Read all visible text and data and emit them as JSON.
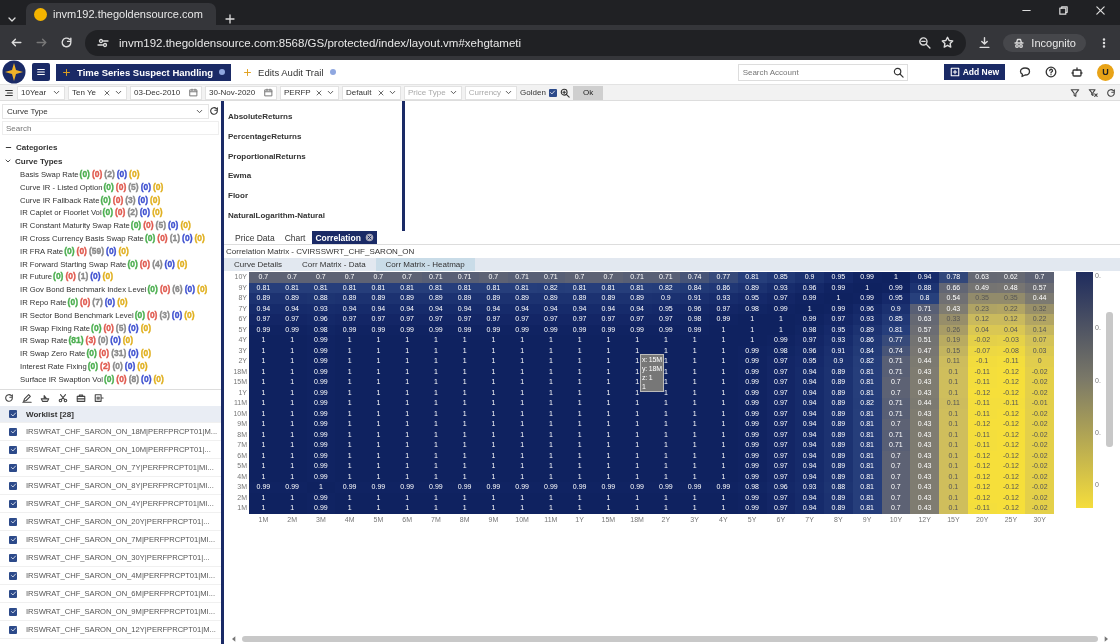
{
  "browser": {
    "tab_title": "invm192.thegoldensource.com",
    "url": "invm192.thegoldensource.com:8568/GS/protected/index/layout.vm#xehgtameti",
    "profile": "Incognito"
  },
  "app_tabs": [
    {
      "label": "Time Series Suspect Handling",
      "selected": true
    },
    {
      "label": "Edits Audit Trail",
      "selected": false
    }
  ],
  "search_account": {
    "placeholder": "Search Account"
  },
  "add_button": "Add New",
  "avatar": "U",
  "filters": [
    {
      "kind": "select",
      "value": "10Year",
      "clear": false
    },
    {
      "kind": "select",
      "value": "Ten Ye",
      "clear": true
    },
    {
      "kind": "date",
      "value": "03-Dec-2010"
    },
    {
      "kind": "date",
      "value": "30-Nov-2020"
    },
    {
      "kind": "select",
      "value": "PERFP",
      "clear": true
    },
    {
      "kind": "select",
      "value": "Default",
      "clear": true
    },
    {
      "kind": "select",
      "placeholder": "Price Type",
      "clear": false
    },
    {
      "kind": "select",
      "placeholder": "Currency",
      "clear": false
    },
    {
      "kind": "checkbox",
      "label": "Golden",
      "checked": true
    },
    {
      "kind": "button",
      "label": "Ok"
    }
  ],
  "curve_select": {
    "value": "Curve Type"
  },
  "tree_search": {
    "placeholder": "Search"
  },
  "tree": {
    "label": "Categories",
    "expanded": true,
    "children": [
      {
        "label": "Curve Types",
        "expanded": true,
        "children": [
          {
            "label": "Basis Swap Rate",
            "counts": [
              {
                "text": "(0)",
                "color": "#4caf50"
              },
              {
                "text": "(0)",
                "color": "#e05a4f"
              },
              {
                "text": "(2)",
                "color": "#8a8a8a"
              },
              {
                "text": "(0)",
                "color": "#3f51d0"
              },
              {
                "text": "(0)",
                "color": "#e0b020"
              }
            ]
          },
          {
            "label": "Curve IR - Listed Option",
            "counts": [
              {
                "text": "(0)",
                "color": "#4caf50"
              },
              {
                "text": "(0)",
                "color": "#e05a4f"
              },
              {
                "text": "(5)",
                "color": "#8a8a8a"
              },
              {
                "text": "(0)",
                "color": "#3f51d0"
              },
              {
                "text": "(0)",
                "color": "#e0b020"
              }
            ]
          },
          {
            "label": "Curve IR Fallback Rate",
            "counts": [
              {
                "text": "(0)",
                "color": "#4caf50"
              },
              {
                "text": "(0)",
                "color": "#e05a4f"
              },
              {
                "text": "(3)",
                "color": "#8a8a8a"
              },
              {
                "text": "(0)",
                "color": "#3f51d0"
              },
              {
                "text": "(0)",
                "color": "#e0b020"
              }
            ]
          },
          {
            "label": "IR Caplet or Floorlet Vol",
            "counts": [
              {
                "text": "(0)",
                "color": "#4caf50"
              },
              {
                "text": "(0)",
                "color": "#e05a4f"
              },
              {
                "text": "(2)",
                "color": "#8a8a8a"
              },
              {
                "text": "(0)",
                "color": "#3f51d0"
              },
              {
                "text": "(0)",
                "color": "#e0b020"
              }
            ]
          },
          {
            "label": "IR Constant Maturity Swap Rate",
            "counts": [
              {
                "text": "(0)",
                "color": "#4caf50"
              },
              {
                "text": "(0)",
                "color": "#e05a4f"
              },
              {
                "text": "(5)",
                "color": "#8a8a8a"
              },
              {
                "text": "(0)",
                "color": "#3f51d0"
              },
              {
                "text": "(0)",
                "color": "#e0b020"
              }
            ]
          },
          {
            "label": "IR Cross Currency Basis Swap Rate",
            "counts": [
              {
                "text": "(0)",
                "color": "#4caf50"
              },
              {
                "text": "(0)",
                "color": "#e05a4f"
              },
              {
                "text": "(1)",
                "color": "#8a8a8a"
              },
              {
                "text": "(0)",
                "color": "#3f51d0"
              },
              {
                "text": "(0)",
                "color": "#e0b020"
              }
            ]
          },
          {
            "label": "IR FRA Rate",
            "counts": [
              {
                "text": "(0)",
                "color": "#4caf50"
              },
              {
                "text": "(0)",
                "color": "#e05a4f"
              },
              {
                "text": "(59)",
                "color": "#8a8a8a"
              },
              {
                "text": "(0)",
                "color": "#3f51d0"
              },
              {
                "text": "(0)",
                "color": "#e0b020"
              }
            ]
          },
          {
            "label": "IR Forward Starting Swap Rate",
            "counts": [
              {
                "text": "(0)",
                "color": "#4caf50"
              },
              {
                "text": "(0)",
                "color": "#e05a4f"
              },
              {
                "text": "(4)",
                "color": "#8a8a8a"
              },
              {
                "text": "(0)",
                "color": "#3f51d0"
              },
              {
                "text": "(0)",
                "color": "#e0b020"
              }
            ]
          },
          {
            "label": "IR Future",
            "counts": [
              {
                "text": "(0)",
                "color": "#4caf50"
              },
              {
                "text": "(0)",
                "color": "#e05a4f"
              },
              {
                "text": "(1)",
                "color": "#8a8a8a"
              },
              {
                "text": "(0)",
                "color": "#3f51d0"
              },
              {
                "text": "(0)",
                "color": "#e0b020"
              }
            ]
          },
          {
            "label": "IR Gov Bond Benchmark Index Level",
            "counts": [
              {
                "text": "(0)",
                "color": "#4caf50"
              },
              {
                "text": "(0)",
                "color": "#e05a4f"
              },
              {
                "text": "(6)",
                "color": "#8a8a8a"
              },
              {
                "text": "(0)",
                "color": "#3f51d0"
              },
              {
                "text": "(0)",
                "color": "#e0b020"
              }
            ]
          },
          {
            "label": "IR Repo Rate",
            "counts": [
              {
                "text": "(0)",
                "color": "#4caf50"
              },
              {
                "text": "(0)",
                "color": "#e05a4f"
              },
              {
                "text": "(7)",
                "color": "#8a8a8a"
              },
              {
                "text": "(0)",
                "color": "#3f51d0"
              },
              {
                "text": "(0)",
                "color": "#e0b020"
              }
            ]
          },
          {
            "label": "IR Sector Bond Benchmark Level",
            "counts": [
              {
                "text": "(0)",
                "color": "#4caf50"
              },
              {
                "text": "(0)",
                "color": "#e05a4f"
              },
              {
                "text": "(3)",
                "color": "#8a8a8a"
              },
              {
                "text": "(0)",
                "color": "#3f51d0"
              },
              {
                "text": "(0)",
                "color": "#e0b020"
              }
            ]
          },
          {
            "label": "IR Swap Fixing Rate",
            "counts": [
              {
                "text": "(0)",
                "color": "#4caf50"
              },
              {
                "text": "(0)",
                "color": "#e05a4f"
              },
              {
                "text": "(5)",
                "color": "#8a8a8a"
              },
              {
                "text": "(0)",
                "color": "#3f51d0"
              },
              {
                "text": "(0)",
                "color": "#e0b020"
              }
            ]
          },
          {
            "label": "IR Swap Rate",
            "counts": [
              {
                "text": "(81)",
                "color": "#4caf50"
              },
              {
                "text": "(3)",
                "color": "#e05a4f"
              },
              {
                "text": "(0)",
                "color": "#8a8a8a"
              },
              {
                "text": "(0)",
                "color": "#3f51d0"
              },
              {
                "text": "(0)",
                "color": "#e0b020"
              }
            ]
          },
          {
            "label": "IR Swap Zero Rate",
            "counts": [
              {
                "text": "(0)",
                "color": "#4caf50"
              },
              {
                "text": "(0)",
                "color": "#e05a4f"
              },
              {
                "text": "(31)",
                "color": "#8a8a8a"
              },
              {
                "text": "(0)",
                "color": "#3f51d0"
              },
              {
                "text": "(0)",
                "color": "#e0b020"
              }
            ]
          },
          {
            "label": "Interest Rate Fixing",
            "counts": [
              {
                "text": "(0)",
                "color": "#4caf50"
              },
              {
                "text": "(2)",
                "color": "#e05a4f"
              },
              {
                "text": "(0)",
                "color": "#8a8a8a"
              },
              {
                "text": "(0)",
                "color": "#3f51d0"
              },
              {
                "text": "(0)",
                "color": "#e0b020"
              }
            ]
          },
          {
            "label": "Surface IR Swaption Vol",
            "counts": [
              {
                "text": "(0)",
                "color": "#4caf50"
              },
              {
                "text": "(0)",
                "color": "#e05a4f"
              },
              {
                "text": "(8)",
                "color": "#8a8a8a"
              },
              {
                "text": "(0)",
                "color": "#3f51d0"
              },
              {
                "text": "(0)",
                "color": "#e0b020"
              }
            ]
          }
        ]
      }
    ]
  },
  "worklist": {
    "title": "Worklist [28]",
    "checked": true,
    "items": [
      {
        "label": "IRSWRAT_CHF_SARON_ON_18M|PERFPRCPT01|M...",
        "checked": true
      },
      {
        "label": "IRSWRAT_CHF_SARON_ON_10M|PERFPRCPT01|...",
        "checked": true
      },
      {
        "label": "IRSWRAT_CHF_SARON_ON_7Y|PERFPRCPT01|MI...",
        "checked": true
      },
      {
        "label": "IRSWRAT_CHF_SARON_ON_8Y|PERFPRCPT01|MI...",
        "checked": true
      },
      {
        "label": "IRSWRAT_CHF_SARON_ON_4Y|PERFPRCPT01|MI...",
        "checked": true
      },
      {
        "label": "IRSWRAT_CHF_SARON_ON_20Y|PERFPRCPT01|...",
        "checked": true
      },
      {
        "label": "IRSWRAT_CHF_SARON_ON_7M|PERFPRCPT01|MI...",
        "checked": true
      },
      {
        "label": "IRSWRAT_CHF_SARON_ON_30Y|PERFPRCPT01|...",
        "checked": true
      },
      {
        "label": "IRSWRAT_CHF_SARON_ON_4M|PERFPRCPT01|MI...",
        "checked": true
      },
      {
        "label": "IRSWRAT_CHF_SARON_ON_6M|PERFPRCPT01|MI...",
        "checked": true
      },
      {
        "label": "IRSWRAT_CHF_SARON_ON_9M|PERFPRCPT01|MI...",
        "checked": true
      },
      {
        "label": "IRSWRAT_CHF_SARON_ON_12Y|PERFPRCPT01|M...",
        "checked": true
      }
    ]
  },
  "functions": [
    "AbsoluteReturns",
    "PercentageReturns",
    "ProportionalReturns",
    "Ewma",
    "Floor",
    "NaturalLogarithm-Natural"
  ],
  "view_tabs": [
    {
      "label": "Price Data",
      "selected": false,
      "closable": false
    },
    {
      "label": "Chart",
      "selected": false,
      "closable": false
    },
    {
      "label": "Correlation",
      "selected": true,
      "closable": true
    }
  ],
  "matrix_title": "Correlation Matrix - CVIRSSWRT_CHF_SARON_ON",
  "sub_tabs": [
    {
      "label": "Curve Details",
      "selected": false
    },
    {
      "label": "Corr Matrix - Data",
      "selected": false
    },
    {
      "label": "Corr Matrix - Heatmap",
      "selected": true
    }
  ],
  "heatmap": {
    "columns": [
      "1M",
      "2M",
      "3M",
      "4M",
      "5M",
      "6M",
      "7M",
      "8M",
      "9M",
      "10M",
      "11M",
      "1Y",
      "15M",
      "18M",
      "2Y",
      "3Y",
      "4Y",
      "5Y",
      "6Y",
      "7Y",
      "8Y",
      "9Y",
      "10Y",
      "12Y",
      "15Y",
      "20Y",
      "25Y",
      "30Y"
    ],
    "rows": [
      {
        "label": "10Y",
        "values": [
          "0.7",
          "0.7",
          "0.7",
          "0.7",
          "0.7",
          "0.7",
          "0.71",
          "0.71",
          "0.7",
          "0.71",
          "0.71",
          "0.7",
          "0.7",
          "0.71",
          "0.71",
          "0.74",
          "0.77",
          "0.81",
          "0.85",
          "0.9",
          "0.95",
          "0.99",
          "1",
          "0.94",
          "0.78",
          "0.63",
          "0.62",
          "0.7"
        ]
      },
      {
        "label": "9Y",
        "values": [
          "0.81",
          "0.81",
          "0.81",
          "0.81",
          "0.81",
          "0.81",
          "0.81",
          "0.81",
          "0.81",
          "0.81",
          "0.82",
          "0.81",
          "0.81",
          "0.81",
          "0.82",
          "0.84",
          "0.86",
          "0.89",
          "0.93",
          "0.96",
          "0.99",
          "1",
          "0.99",
          "0.88",
          "0.66",
          "0.49",
          "0.48",
          "0.57"
        ]
      },
      {
        "label": "8Y",
        "values": [
          "0.89",
          "0.89",
          "0.88",
          "0.89",
          "0.89",
          "0.89",
          "0.89",
          "0.89",
          "0.89",
          "0.89",
          "0.89",
          "0.89",
          "0.89",
          "0.89",
          "0.9",
          "0.91",
          "0.93",
          "0.95",
          "0.97",
          "0.99",
          "1",
          "0.99",
          "0.95",
          "0.8",
          "0.54",
          "0.35",
          "0.35",
          "0.44"
        ]
      },
      {
        "label": "7Y",
        "values": [
          "0.94",
          "0.94",
          "0.93",
          "0.94",
          "0.94",
          "0.94",
          "0.94",
          "0.94",
          "0.94",
          "0.94",
          "0.94",
          "0.94",
          "0.94",
          "0.94",
          "0.95",
          "0.96",
          "0.97",
          "0.98",
          "0.99",
          "1",
          "0.99",
          "0.96",
          "0.9",
          "0.71",
          "0.43",
          "0.23",
          "0.22",
          "0.32"
        ]
      },
      {
        "label": "6Y",
        "values": [
          "0.97",
          "0.97",
          "0.96",
          "0.97",
          "0.97",
          "0.97",
          "0.97",
          "0.97",
          "0.97",
          "0.97",
          "0.97",
          "0.97",
          "0.97",
          "0.97",
          "0.97",
          "0.98",
          "0.99",
          "1",
          "1",
          "0.99",
          "0.97",
          "0.93",
          "0.85",
          "0.63",
          "0.33",
          "0.12",
          "0.12",
          "0.22"
        ]
      },
      {
        "label": "5Y",
        "values": [
          "0.99",
          "0.99",
          "0.98",
          "0.99",
          "0.99",
          "0.99",
          "0.99",
          "0.99",
          "0.99",
          "0.99",
          "0.99",
          "0.99",
          "0.99",
          "0.99",
          "0.99",
          "0.99",
          "1",
          "1",
          "1",
          "0.98",
          "0.95",
          "0.89",
          "0.81",
          "0.57",
          "0.26",
          "0.04",
          "0.04",
          "0.14"
        ]
      },
      {
        "label": "4Y",
        "values": [
          "1",
          "1",
          "0.99",
          "1",
          "1",
          "1",
          "1",
          "1",
          "1",
          "1",
          "1",
          "1",
          "1",
          "1",
          "1",
          "1",
          "1",
          "1",
          "0.99",
          "0.97",
          "0.93",
          "0.86",
          "0.77",
          "0.51",
          "0.19",
          "-0.02",
          "-0.03",
          "0.07"
        ]
      },
      {
        "label": "3Y",
        "values": [
          "1",
          "1",
          "0.99",
          "1",
          "1",
          "1",
          "1",
          "1",
          "1",
          "1",
          "1",
          "1",
          "1",
          "1",
          "1",
          "1",
          "1",
          "0.99",
          "0.98",
          "0.96",
          "0.91",
          "0.84",
          "0.74",
          "0.47",
          "0.15",
          "-0.07",
          "-0.08",
          "0.03"
        ]
      },
      {
        "label": "2Y",
        "values": [
          "1",
          "1",
          "0.99",
          "1",
          "1",
          "1",
          "1",
          "1",
          "1",
          "1",
          "1",
          "1",
          "1",
          "1",
          "1",
          "1",
          "1",
          "0.99",
          "0.97",
          "0.95",
          "0.9",
          "0.82",
          "0.71",
          "0.44",
          "0.11",
          "-0.1",
          "-0.11",
          "0"
        ]
      },
      {
        "label": "18M",
        "values": [
          "1",
          "1",
          "0.99",
          "1",
          "1",
          "1",
          "1",
          "1",
          "1",
          "1",
          "1",
          "1",
          "1",
          "1",
          "1",
          "1",
          "1",
          "0.99",
          "0.97",
          "0.94",
          "0.89",
          "0.81",
          "0.71",
          "0.43",
          "0.1",
          "-0.11",
          "-0.12",
          "-0.02"
        ]
      },
      {
        "label": "15M",
        "values": [
          "1",
          "1",
          "0.99",
          "1",
          "1",
          "1",
          "1",
          "1",
          "1",
          "1",
          "1",
          "1",
          "1",
          "1",
          "1",
          "1",
          "1",
          "0.99",
          "0.97",
          "0.94",
          "0.89",
          "0.81",
          "0.7",
          "0.43",
          "0.1",
          "-0.11",
          "-0.12",
          "-0.02"
        ]
      },
      {
        "label": "1Y",
        "values": [
          "1",
          "1",
          "0.99",
          "1",
          "1",
          "1",
          "1",
          "1",
          "1",
          "1",
          "1",
          "1",
          "1",
          "1",
          "1",
          "1",
          "1",
          "0.99",
          "0.97",
          "0.94",
          "0.89",
          "0.81",
          "0.7",
          "0.43",
          "0.1",
          "-0.12",
          "-0.12",
          "-0.02"
        ]
      },
      {
        "label": "11M",
        "values": [
          "1",
          "1",
          "0.99",
          "1",
          "1",
          "1",
          "1",
          "1",
          "1",
          "1",
          "1",
          "1",
          "1",
          "1",
          "1",
          "1",
          "1",
          "0.99",
          "0.97",
          "0.94",
          "0.89",
          "0.82",
          "0.71",
          "0.44",
          "0.11",
          "-0.11",
          "-0.11",
          "-0.01"
        ]
      },
      {
        "label": "10M",
        "values": [
          "1",
          "1",
          "0.99",
          "1",
          "1",
          "1",
          "1",
          "1",
          "1",
          "1",
          "1",
          "1",
          "1",
          "1",
          "1",
          "1",
          "1",
          "0.99",
          "0.97",
          "0.94",
          "0.89",
          "0.81",
          "0.71",
          "0.43",
          "0.1",
          "-0.11",
          "-0.12",
          "-0.02"
        ]
      },
      {
        "label": "9M",
        "values": [
          "1",
          "1",
          "0.99",
          "1",
          "1",
          "1",
          "1",
          "1",
          "1",
          "1",
          "1",
          "1",
          "1",
          "1",
          "1",
          "1",
          "1",
          "0.99",
          "0.97",
          "0.94",
          "0.89",
          "0.81",
          "0.7",
          "0.43",
          "0.1",
          "-0.12",
          "-0.12",
          "-0.02"
        ]
      },
      {
        "label": "8M",
        "values": [
          "1",
          "1",
          "0.99",
          "1",
          "1",
          "1",
          "1",
          "1",
          "1",
          "1",
          "1",
          "1",
          "1",
          "1",
          "1",
          "1",
          "1",
          "0.99",
          "0.97",
          "0.94",
          "0.89",
          "0.81",
          "0.71",
          "0.43",
          "0.1",
          "-0.11",
          "-0.12",
          "-0.02"
        ]
      },
      {
        "label": "7M",
        "values": [
          "1",
          "1",
          "0.99",
          "1",
          "1",
          "1",
          "1",
          "1",
          "1",
          "1",
          "1",
          "1",
          "1",
          "1",
          "1",
          "1",
          "1",
          "0.99",
          "0.97",
          "0.94",
          "0.89",
          "0.81",
          "0.71",
          "0.43",
          "0.1",
          "-0.11",
          "-0.12",
          "-0.02"
        ]
      },
      {
        "label": "6M",
        "values": [
          "1",
          "1",
          "0.99",
          "1",
          "1",
          "1",
          "1",
          "1",
          "1",
          "1",
          "1",
          "1",
          "1",
          "1",
          "1",
          "1",
          "1",
          "0.99",
          "0.97",
          "0.94",
          "0.89",
          "0.81",
          "0.7",
          "0.43",
          "0.1",
          "-0.12",
          "-0.12",
          "-0.02"
        ]
      },
      {
        "label": "5M",
        "values": [
          "1",
          "1",
          "0.99",
          "1",
          "1",
          "1",
          "1",
          "1",
          "1",
          "1",
          "1",
          "1",
          "1",
          "1",
          "1",
          "1",
          "1",
          "0.99",
          "0.97",
          "0.94",
          "0.89",
          "0.81",
          "0.7",
          "0.43",
          "0.1",
          "-0.12",
          "-0.12",
          "-0.02"
        ]
      },
      {
        "label": "4M",
        "values": [
          "1",
          "1",
          "0.99",
          "1",
          "1",
          "1",
          "1",
          "1",
          "1",
          "1",
          "1",
          "1",
          "1",
          "1",
          "1",
          "1",
          "1",
          "0.99",
          "0.97",
          "0.94",
          "0.89",
          "0.81",
          "0.7",
          "0.43",
          "0.1",
          "-0.12",
          "-0.12",
          "-0.02"
        ]
      },
      {
        "label": "3M",
        "values": [
          "0.99",
          "0.99",
          "1",
          "0.99",
          "0.99",
          "0.99",
          "0.99",
          "0.99",
          "0.99",
          "0.99",
          "0.99",
          "0.99",
          "0.99",
          "0.99",
          "0.99",
          "0.99",
          "0.99",
          "0.98",
          "0.96",
          "0.93",
          "0.88",
          "0.81",
          "0.7",
          "0.43",
          "0.1",
          "-0.12",
          "-0.12",
          "-0.02"
        ]
      },
      {
        "label": "2M",
        "values": [
          "1",
          "1",
          "0.99",
          "1",
          "1",
          "1",
          "1",
          "1",
          "1",
          "1",
          "1",
          "1",
          "1",
          "1",
          "1",
          "1",
          "1",
          "0.99",
          "0.97",
          "0.94",
          "0.89",
          "0.81",
          "0.7",
          "0.43",
          "0.1",
          "-0.12",
          "-0.12",
          "-0.02"
        ]
      },
      {
        "label": "1M",
        "values": [
          "1",
          "1",
          "0.99",
          "1",
          "1",
          "1",
          "1",
          "1",
          "1",
          "1",
          "1",
          "1",
          "1",
          "1",
          "1",
          "1",
          "1",
          "0.99",
          "0.97",
          "0.94",
          "0.89",
          "0.81",
          "0.7",
          "0.43",
          "0.1",
          "-0.11",
          "-0.12",
          "-0.02"
        ]
      }
    ],
    "tooltip": [
      "x: 15M",
      "y: 18M",
      "z: 1",
      "1"
    ],
    "legend_ticks": [
      "0.",
      "0.",
      "0.",
      "0.",
      "0"
    ]
  }
}
